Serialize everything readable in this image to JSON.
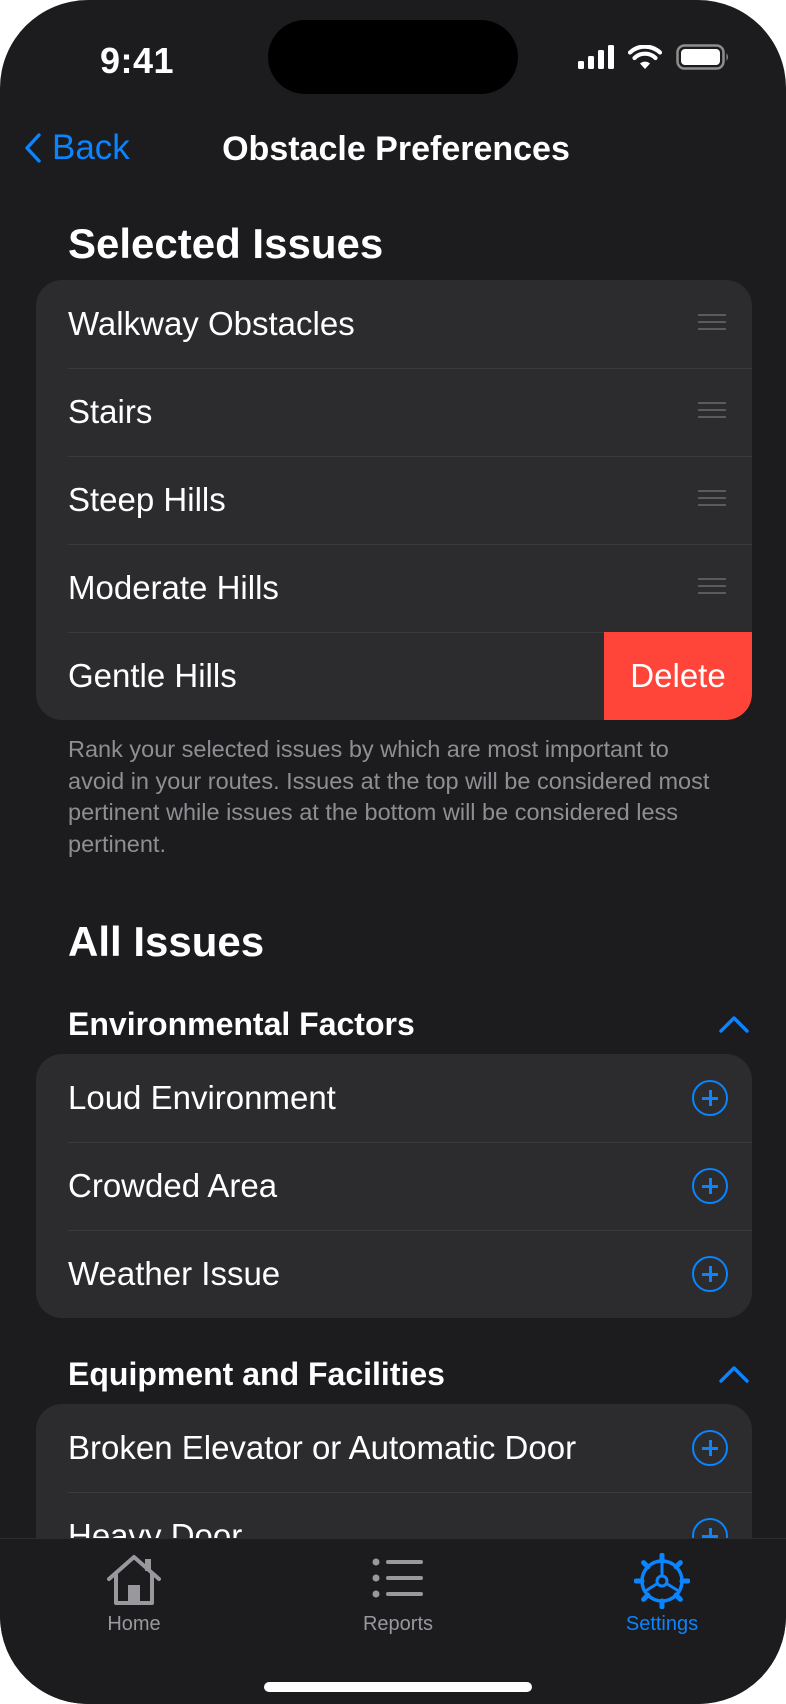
{
  "status_bar": {
    "time": "9:41"
  },
  "nav": {
    "back_label": "Back",
    "title": "Obstacle Preferences"
  },
  "selected": {
    "title": "Selected Issues",
    "items": [
      {
        "label": "Walkway Obstacles"
      },
      {
        "label": "Stairs"
      },
      {
        "label": "Steep Hills"
      },
      {
        "label": "Moderate Hills"
      },
      {
        "label": "Gentle Hills"
      }
    ],
    "delete_label": "Delete",
    "note": "Rank your selected issues by which are most important to avoid in your routes. Issues at the top will be considered most pertinent while issues at the bottom will be considered less pertinent."
  },
  "all_issues": {
    "title": "All Issues",
    "groups": [
      {
        "title": "Environmental Factors",
        "items": [
          {
            "label": "Loud Environment"
          },
          {
            "label": "Crowded Area"
          },
          {
            "label": "Weather Issue"
          }
        ]
      },
      {
        "title": "Equipment and Facilities",
        "items": [
          {
            "label": "Broken Elevator or Automatic Door"
          },
          {
            "label": "Heavy Door"
          }
        ]
      }
    ]
  },
  "tabs": [
    {
      "label": "Home",
      "icon": "house-icon",
      "selected": false
    },
    {
      "label": "Reports",
      "icon": "list-icon",
      "selected": false
    },
    {
      "label": "Settings",
      "icon": "gear-icon",
      "selected": true
    }
  ],
  "colors": {
    "accent": "#0a84ff",
    "delete": "#ff453a",
    "background": "#1c1c1e",
    "card": "#2c2c2e"
  }
}
